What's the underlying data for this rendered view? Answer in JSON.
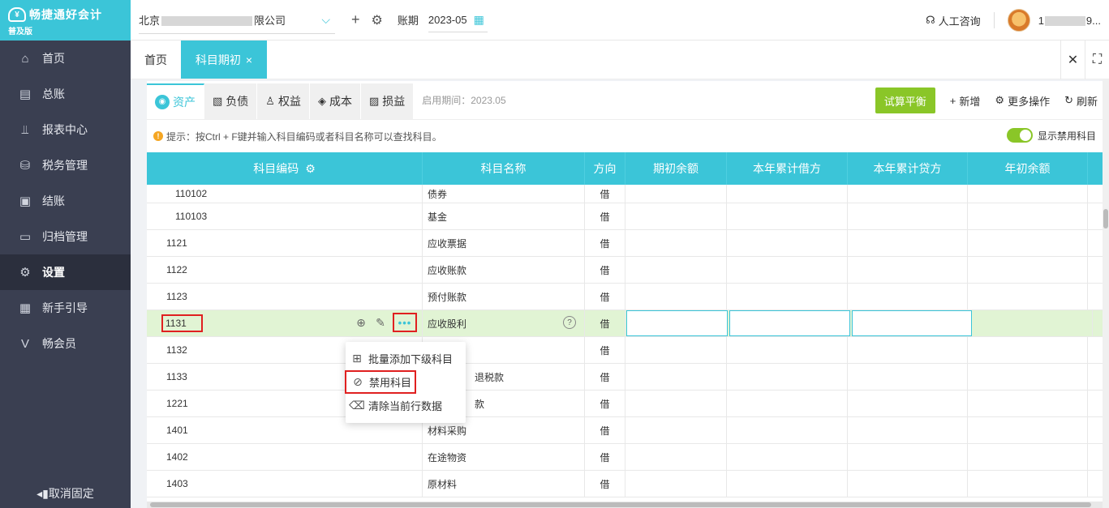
{
  "app": {
    "title": "畅捷通好会计",
    "edition": "普及版"
  },
  "sidebar": {
    "items": [
      {
        "label": "首页",
        "icon": "home-icon"
      },
      {
        "label": "总账",
        "icon": "ledger-icon"
      },
      {
        "label": "报表中心",
        "icon": "chart-icon"
      },
      {
        "label": "税务管理",
        "icon": "tax-icon"
      },
      {
        "label": "结账",
        "icon": "close-account-icon"
      },
      {
        "label": "归档管理",
        "icon": "archive-icon"
      },
      {
        "label": "设置",
        "icon": "gear-icon"
      },
      {
        "label": "新手引导",
        "icon": "guide-icon"
      },
      {
        "label": "畅会员",
        "icon": "member-icon"
      }
    ],
    "unpin_label": "取消固定"
  },
  "header": {
    "company_prefix": "北京",
    "company_suffix": "限公司",
    "period_label": "账期",
    "period_value": "2023-05",
    "consult_label": "人工咨询",
    "user_prefix": "1",
    "user_suffix": "9..."
  },
  "tabs": {
    "home": "首页",
    "active": "科目期初"
  },
  "categories": [
    {
      "label": "资产",
      "active": true
    },
    {
      "label": "负债",
      "active": false
    },
    {
      "label": "权益",
      "active": false
    },
    {
      "label": "成本",
      "active": false
    },
    {
      "label": "损益",
      "active": false
    }
  ],
  "start_period": "启用期间：2023.05",
  "toolbar": {
    "trial_balance": "试算平衡",
    "add": "新增",
    "more": "更多操作",
    "refresh": "刷新"
  },
  "hint": "提示：按Ctrl + F键并输入科目编码或者科目名称可以查找科目。",
  "toggle_label": "显示禁用科目",
  "colors": {
    "accent": "#3bc5d8",
    "sidebar": "#3a3f51",
    "green": "#8ac628",
    "highlight": "#e02020",
    "selected_row": "#e1f4d4"
  },
  "table": {
    "headers": [
      "科目编码",
      "科目名称",
      "方向",
      "期初余额",
      "本年累计借方",
      "本年累计贷方",
      "年初余额"
    ],
    "rows": [
      {
        "code": "110102",
        "name": "债券",
        "dir": "借"
      },
      {
        "code": "110103",
        "name": "基金",
        "dir": "借"
      },
      {
        "code": "1121",
        "name": "应收票据",
        "dir": "借"
      },
      {
        "code": "1122",
        "name": "应收账款",
        "dir": "借"
      },
      {
        "code": "1123",
        "name": "预付账款",
        "dir": "借"
      },
      {
        "code": "1131",
        "name": "应收股利",
        "dir": "借"
      },
      {
        "code": "1132",
        "name": "",
        "dir": "借"
      },
      {
        "code": "1133",
        "name": "退税款",
        "dir": "借"
      },
      {
        "code": "1221",
        "name": "款",
        "dir": "借"
      },
      {
        "code": "1401",
        "name": "材料采购",
        "dir": "借"
      },
      {
        "code": "1402",
        "name": "在途物资",
        "dir": "借"
      },
      {
        "code": "1403",
        "name": "原材料",
        "dir": "借"
      }
    ]
  },
  "context_menu": {
    "items": [
      {
        "label": "批量添加下级科目"
      },
      {
        "label": "禁用科目"
      },
      {
        "label": "清除当前行数据"
      }
    ]
  }
}
